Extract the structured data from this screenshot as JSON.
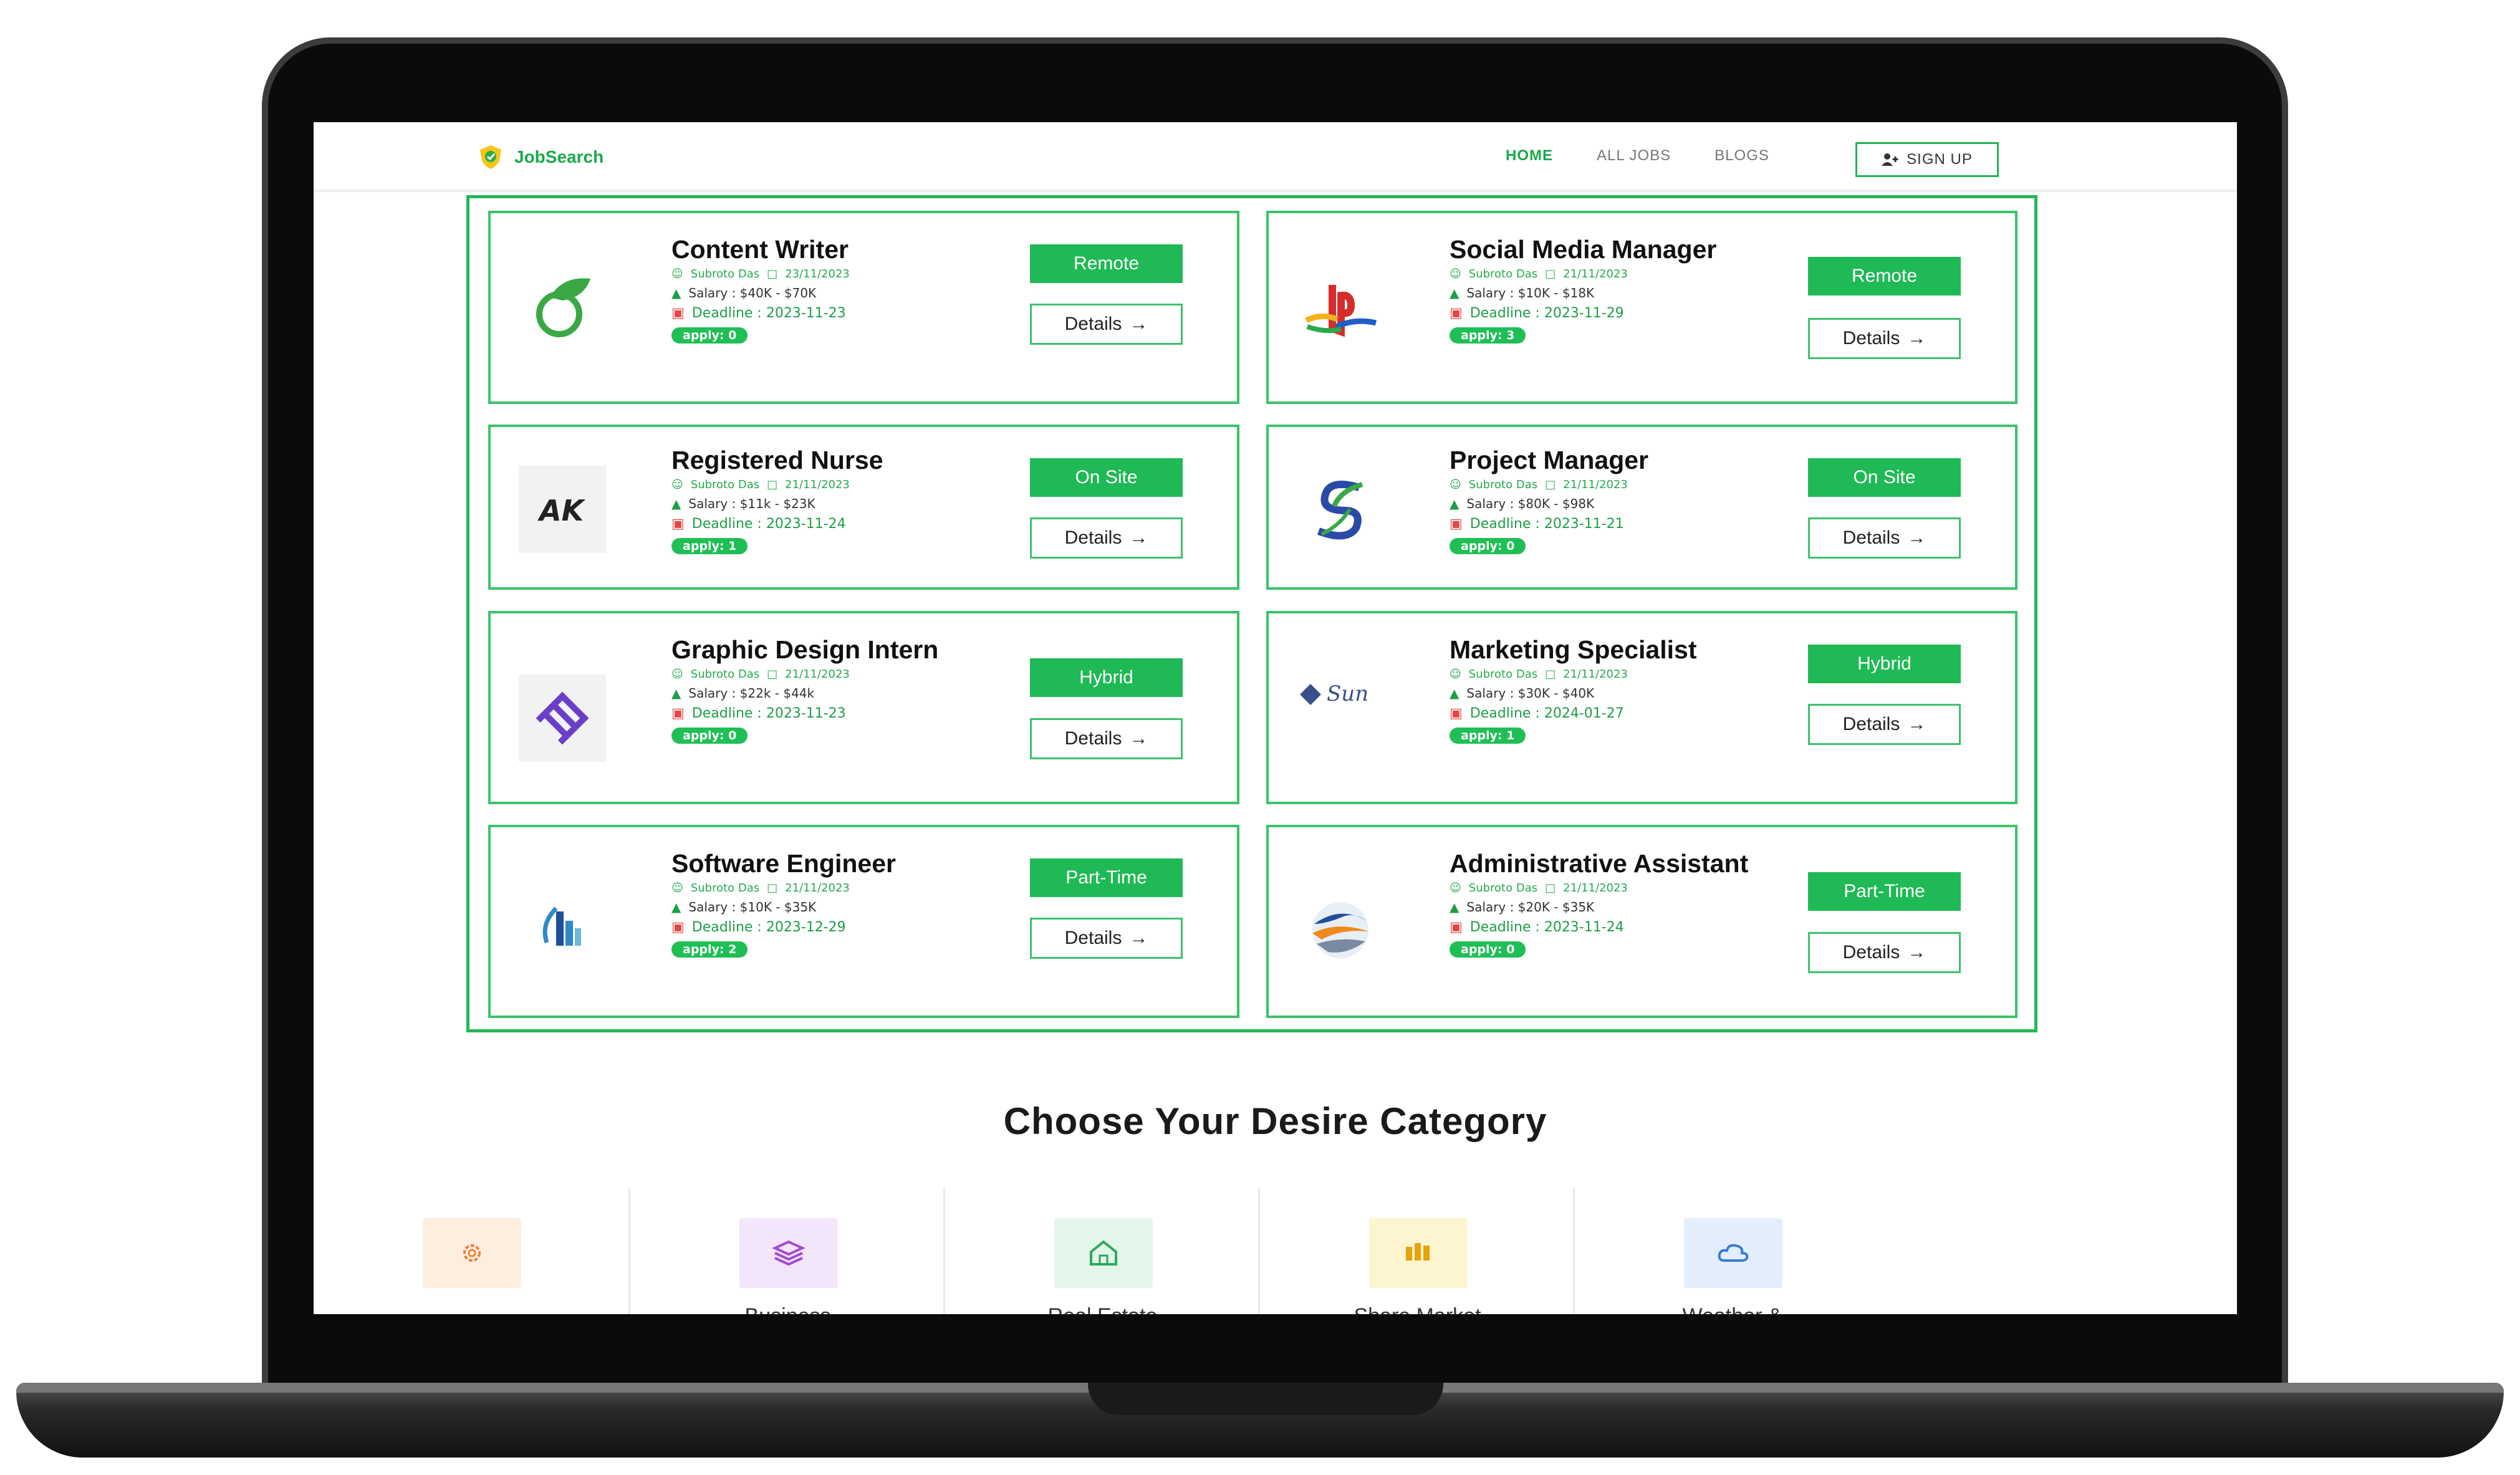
{
  "nav": {
    "brand": "JobSearch",
    "links": [
      "HOME",
      "ALL JOBS",
      "BLOGS"
    ],
    "signup": "SIGN UP"
  },
  "jobs": [
    {
      "title": "Content Writer",
      "poster": "Subroto Das",
      "date": "23/11/2023",
      "salary": "Salary : $40K  -  $70K",
      "deadline": "Deadline : 2023-11-23",
      "apply": "apply: 0",
      "type": "Remote",
      "details": "Details",
      "logo": "leaf-logo-icon"
    },
    {
      "title": "Social Media Manager",
      "poster": "Subroto Das",
      "date": "21/11/2023",
      "salary": "Salary : $10K  -  $18K",
      "deadline": "Deadline : 2023-11-29",
      "apply": "apply: 3",
      "type": "Remote",
      "details": "Details",
      "logo": "playstation-logo-icon"
    },
    {
      "title": "Registered Nurse",
      "poster": "Subroto Das",
      "date": "21/11/2023",
      "salary": "Salary : $11k  -  $23K",
      "deadline": "Deadline : 2023-11-24",
      "apply": "apply: 1",
      "type": "On Site",
      "details": "Details",
      "logo": "ak-logo-icon"
    },
    {
      "title": "Project Manager",
      "poster": "Subroto Das",
      "date": "21/11/2023",
      "salary": "Salary : $80K  -  $98K",
      "deadline": "Deadline : 2023-11-21",
      "apply": "apply: 0",
      "type": "On Site",
      "details": "Details",
      "logo": "s-swirl-logo-icon"
    },
    {
      "title": "Graphic Design Intern",
      "poster": "Subroto Das",
      "date": "21/11/2023",
      "salary": "Salary : $22k  -  $44k",
      "deadline": "Deadline : 2023-11-23",
      "apply": "apply: 0",
      "type": "Hybrid",
      "details": "Details",
      "logo": "purple-diamond-logo-icon"
    },
    {
      "title": "Marketing Specialist",
      "poster": "Subroto Das",
      "date": "21/11/2023",
      "salary": "Salary : $30K  -  $40K",
      "deadline": "Deadline : 2024-01-27",
      "apply": "apply: 1",
      "type": "Hybrid",
      "details": "Details",
      "logo": "sun-logo-icon"
    },
    {
      "title": "Software Engineer",
      "poster": "Subroto Das",
      "date": "21/11/2023",
      "salary": "Salary : $10K  -  $35K",
      "deadline": "Deadline : 2023-12-29",
      "apply": "apply: 2",
      "type": "Part-Time",
      "details": "Details",
      "logo": "building-logo-icon"
    },
    {
      "title": "Administrative Assistant",
      "poster": "Subroto Das",
      "date": "21/11/2023",
      "salary": "Salary : $20K  -  $35K",
      "deadline": "Deadline : 2023-11-24",
      "apply": "apply: 0",
      "type": "Part-Time",
      "details": "Details",
      "logo": "globe-logo-icon"
    }
  ],
  "category": {
    "title": "Choose Your Desire Category",
    "items": [
      {
        "label": "",
        "icon": "gear-icon",
        "bg": "#fdeee0",
        "color": "#f0813a"
      },
      {
        "label": "Business",
        "icon": "layers-icon",
        "bg": "#f3e6fb",
        "color": "#a34ad0"
      },
      {
        "label": "Real Estate",
        "icon": "house-icon",
        "bg": "#e3f6ea",
        "color": "#2eaa5a"
      },
      {
        "label": "Share Market",
        "icon": "chart-bars-icon",
        "bg": "#fdf5cf",
        "color": "#e8a20c"
      },
      {
        "label": "Weather &",
        "icon": "cloud-icon",
        "bg": "#e3eefc",
        "color": "#3a7ad8"
      }
    ]
  },
  "colors": {
    "accent": "#1fb955",
    "brand": "#1aa84a"
  }
}
